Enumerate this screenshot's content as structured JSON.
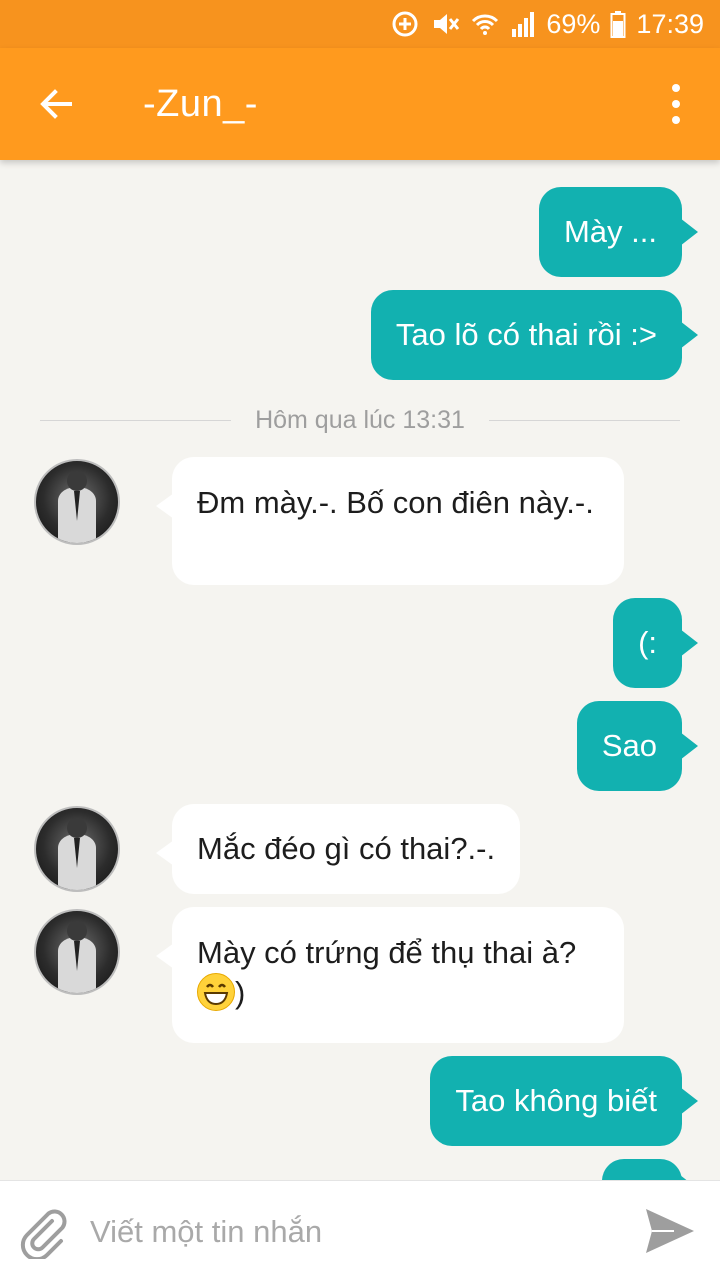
{
  "status_bar": {
    "battery": "69%",
    "time": "17:39",
    "icons": [
      "data-saver-icon",
      "mute-icon",
      "wifi-icon",
      "signal-icon",
      "battery-icon"
    ]
  },
  "app_bar": {
    "title": "-Zun_-",
    "back_icon": "back-arrow-icon",
    "menu_icon": "more-vertical-icon",
    "color": "#ff9a1e"
  },
  "conversation": {
    "separator": "Hôm qua lúc 13:31",
    "messages": [
      {
        "from": "me",
        "text": "Mày ..."
      },
      {
        "from": "me",
        "text": "Tao lõ có thai rồi :>"
      },
      {
        "from": "them",
        "text": "Đm mày.-. Bố con điên này.-."
      },
      {
        "from": "me",
        "text": "(:"
      },
      {
        "from": "me",
        "text": "Sao"
      },
      {
        "from": "them",
        "text": "Mắc đéo gì có thai?.-."
      },
      {
        "from": "them",
        "text": "Mày có trứng để thụ thai à?",
        "suffix": ")"
      },
      {
        "from": "me",
        "text": "Tao không biết"
      }
    ],
    "outgoing_color": "#12b1b0",
    "incoming_color": "#ffffff"
  },
  "composer": {
    "placeholder": "Viết một tin nhắn",
    "attach_icon": "paperclip-icon",
    "send_icon": "send-icon"
  }
}
